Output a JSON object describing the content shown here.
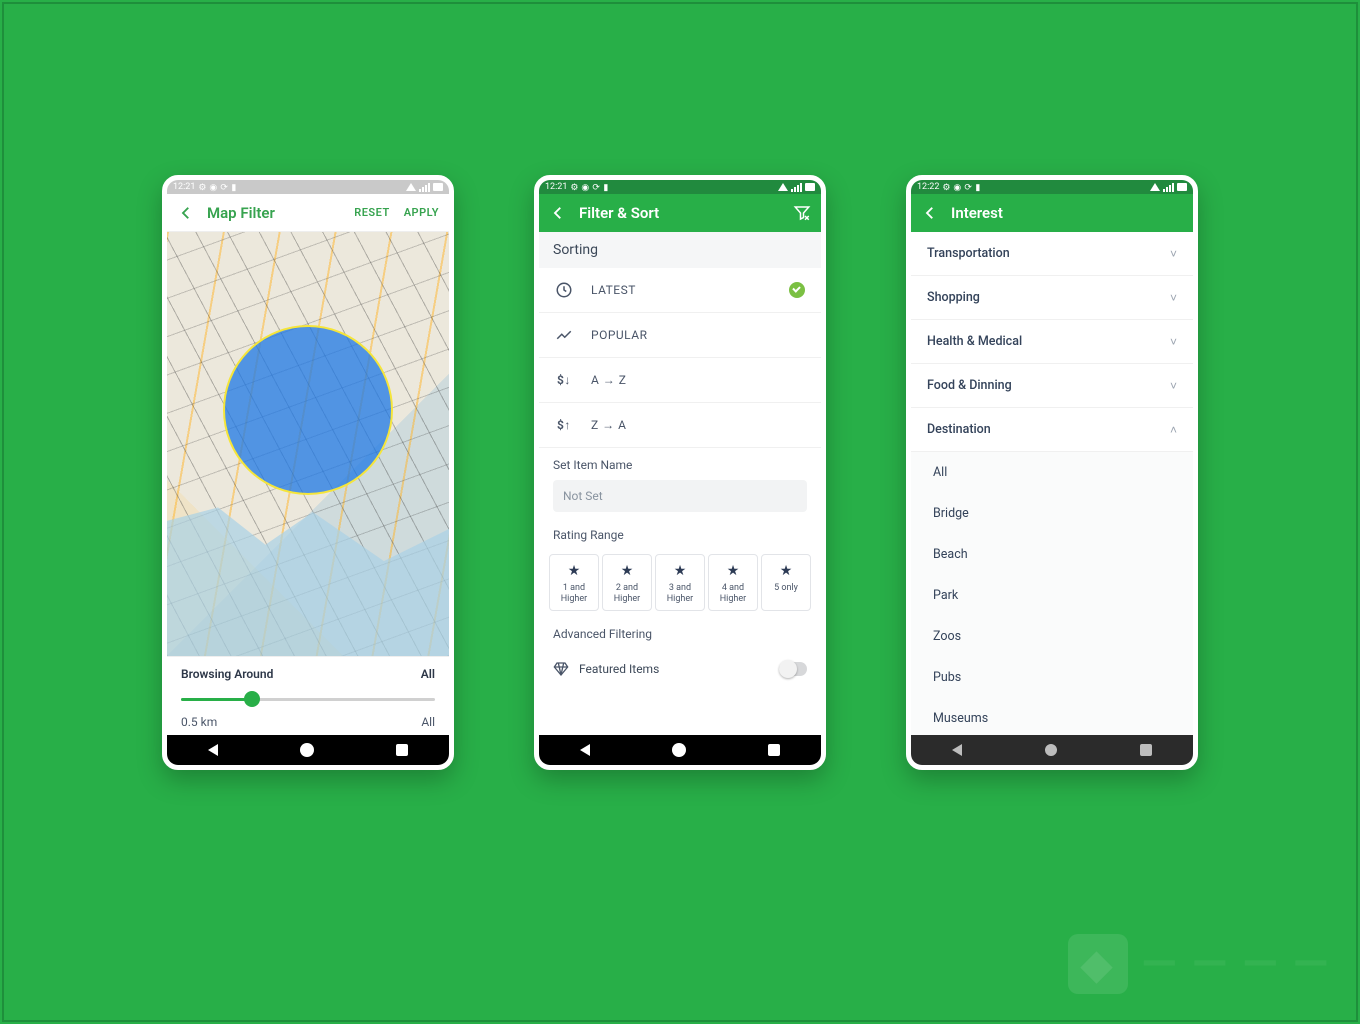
{
  "colors": {
    "brand": "#28af48",
    "accent": "#2d3b55"
  },
  "screen1": {
    "statusbar_time": "12:21",
    "title": "Map Filter",
    "actions": {
      "reset": "RESET",
      "apply": "APPLY"
    },
    "browse_label": "Browsing Around",
    "all_label_top": "All",
    "distance": "0.5 km",
    "all_label_bottom": "All"
  },
  "screen2": {
    "statusbar_time": "12:21",
    "title": "Filter & Sort",
    "sorting_label": "Sorting",
    "options": {
      "latest": "LATEST",
      "popular": "POPULAR",
      "az": "A → Z",
      "za": "Z → A"
    },
    "selected": "latest",
    "item_name_label": "Set Item Name",
    "item_name_placeholder": "Not Set",
    "rating_label": "Rating Range",
    "ratings": [
      "1 and Higher",
      "2 and Higher",
      "3 and Higher",
      "4 and Higher",
      "5 only"
    ],
    "advanced_label": "Advanced Filtering",
    "featured_label": "Featured Items"
  },
  "screen3": {
    "statusbar_time": "12:22",
    "title": "Interest",
    "categories": [
      {
        "name": "Transportation",
        "expanded": false
      },
      {
        "name": "Shopping",
        "expanded": false
      },
      {
        "name": "Health & Medical",
        "expanded": false
      },
      {
        "name": "Food & Dinning",
        "expanded": false
      },
      {
        "name": "Destination",
        "expanded": true,
        "children": [
          "All",
          "Bridge",
          "Beach",
          "Park",
          "Zoos",
          "Pubs",
          "Museums"
        ]
      }
    ]
  }
}
